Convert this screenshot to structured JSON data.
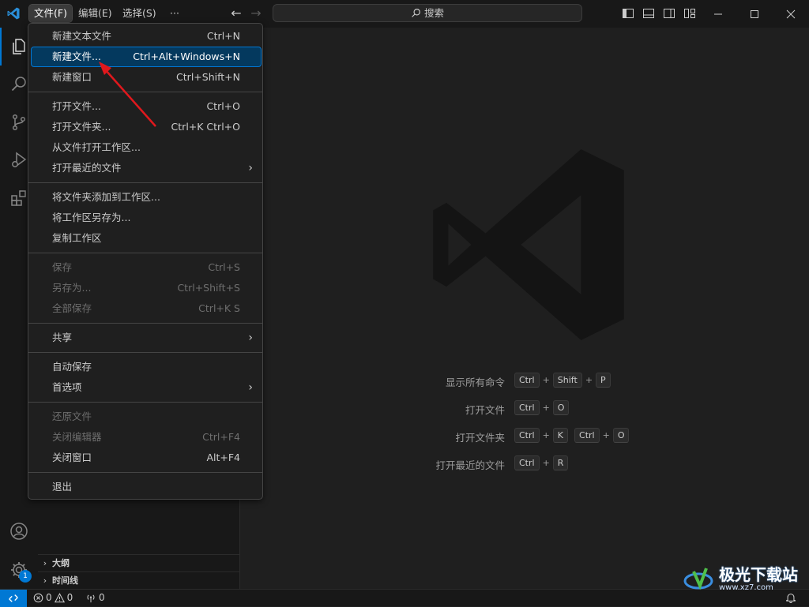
{
  "titlebar": {
    "menus": [
      "文件(F)",
      "编辑(E)",
      "选择(S)",
      "···"
    ],
    "search_placeholder": "搜索"
  },
  "file_menu": {
    "items": [
      {
        "label": "新建文本文件",
        "shortcut": "Ctrl+N"
      },
      {
        "label": "新建文件...",
        "shortcut": "Ctrl+Alt+Windows+N"
      },
      {
        "label": "新建窗口",
        "shortcut": "Ctrl+Shift+N"
      },
      {
        "label": "打开文件...",
        "shortcut": "Ctrl+O"
      },
      {
        "label": "打开文件夹...",
        "shortcut": "Ctrl+K Ctrl+O"
      },
      {
        "label": "从文件打开工作区...",
        "shortcut": ""
      },
      {
        "label": "打开最近的文件",
        "shortcut": ""
      },
      {
        "label": "将文件夹添加到工作区...",
        "shortcut": ""
      },
      {
        "label": "将工作区另存为...",
        "shortcut": ""
      },
      {
        "label": "复制工作区",
        "shortcut": ""
      },
      {
        "label": "保存",
        "shortcut": "Ctrl+S"
      },
      {
        "label": "另存为...",
        "shortcut": "Ctrl+Shift+S"
      },
      {
        "label": "全部保存",
        "shortcut": "Ctrl+K S"
      },
      {
        "label": "共享",
        "shortcut": ""
      },
      {
        "label": "自动保存",
        "shortcut": ""
      },
      {
        "label": "首选项",
        "shortcut": ""
      },
      {
        "label": "还原文件",
        "shortcut": ""
      },
      {
        "label": "关闭编辑器",
        "shortcut": "Ctrl+F4"
      },
      {
        "label": "关闭窗口",
        "shortcut": "Alt+F4"
      },
      {
        "label": "退出",
        "shortcut": ""
      }
    ]
  },
  "sidebar": {
    "sections": [
      "大纲",
      "时间线"
    ]
  },
  "activity": {
    "badge": "1"
  },
  "welcome": {
    "shortcuts": [
      {
        "label": "显示所有命令",
        "keys": [
          "Ctrl",
          "Shift",
          "P"
        ]
      },
      {
        "label": "打开文件",
        "keys": [
          "Ctrl",
          "O"
        ]
      },
      {
        "label": "打开文件夹",
        "keys": [
          "Ctrl",
          "K"
        ],
        "keys2": [
          "Ctrl",
          "O"
        ]
      },
      {
        "label": "打开最近的文件",
        "keys": [
          "Ctrl",
          "R"
        ]
      }
    ]
  },
  "statusbar": {
    "errors": "0",
    "warnings": "0",
    "ports": "0"
  },
  "watermark": {
    "name": "极光下载站",
    "url": "www.xz7.com"
  },
  "colors": {
    "accent": "#0078d4",
    "highlight": "#04395e",
    "arrow": "#e0181d"
  }
}
